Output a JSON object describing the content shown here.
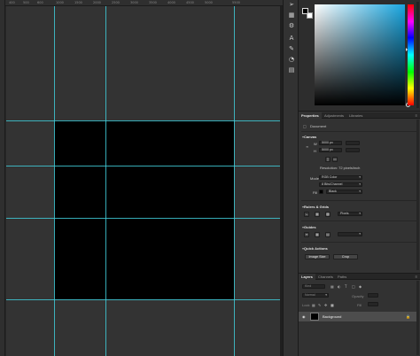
{
  "canvas": {
    "ruler_ticks": [
      "400",
      "500",
      "600",
      "1000",
      "1500",
      "2000",
      "2500",
      "3000",
      "3500",
      "4000",
      "4500",
      "5000",
      "5500"
    ]
  },
  "tools": {
    "icons": [
      "move-icon",
      "swap-colors-icon",
      "adjust-icon",
      "text-icon",
      "brush-icon",
      "history-icon",
      "styles-icon",
      "libraries-icon"
    ]
  },
  "colors": {
    "foreground": "#000000",
    "background": "#ffffff",
    "picker_hue": "#18a6e0",
    "guide": "#3fc9d6"
  },
  "properties": {
    "tabs": [
      "Properties",
      "Adjustments",
      "Libraries"
    ],
    "doc_label": "Document",
    "canvas_head": "Canvas",
    "w_label": "W",
    "w_value": "5000 px",
    "h_label": "H",
    "h_value": "5000 px",
    "resolution": "Resolution: 72 pixels/inch",
    "mode_label": "Mode",
    "mode_value": "RGB Color",
    "depth_value": "8 Bits/Channel",
    "fill_label": "Fill",
    "fill_value": "Black",
    "rulers_head": "Rulers & Grids",
    "units_value": "Pixels",
    "guides_head": "Guides",
    "quick_head": "Quick Actions",
    "image_size_button": "Image Size",
    "crop_button": "Crop"
  },
  "layers": {
    "tabs": [
      "Layers",
      "Channels",
      "Paths"
    ],
    "kind_placeholder": "Kind",
    "blend_mode": "Normal",
    "opacity_label": "Opacity",
    "lock_label": "Lock",
    "fill_label": "Fill",
    "layer_name": "Background"
  }
}
